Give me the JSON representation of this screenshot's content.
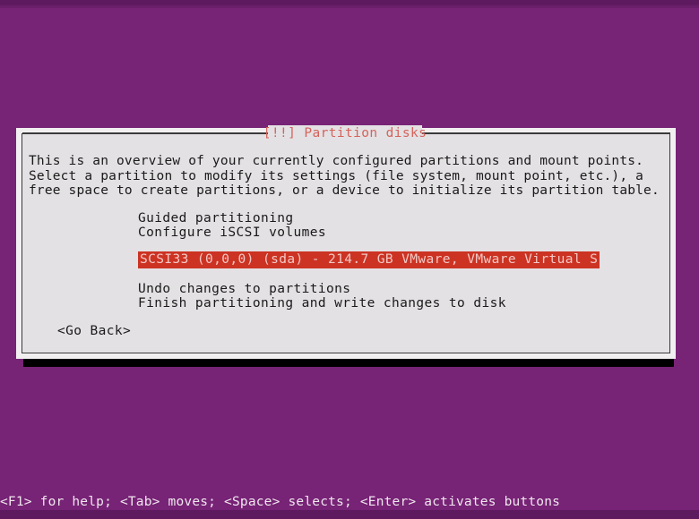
{
  "screen": {
    "background_color": "#772376",
    "top_strip_color": "#5e1a5e"
  },
  "dialog": {
    "title": "[!!] Partition disks",
    "title_color": "#d4645c",
    "background_color": "#e4e1e4",
    "border_color": "#3a3a3a",
    "intro_text": "This is an overview of your currently configured partitions and mount points. Select a partition to modify its settings (file system, mount point, etc.), a free space to create partitions, or a device to initialize its partition table.",
    "menu": {
      "guided_partitioning": "Guided partitioning",
      "configure_iscsi": "Configure iSCSI volumes",
      "selected_disk": "SCSI33 (0,0,0) (sda) - 214.7 GB VMware, VMware Virtual S",
      "undo_changes": "Undo changes to partitions",
      "finish_partitioning": "Finish partitioning and write changes to disk"
    },
    "selection": {
      "highlight_background": "#cc3323",
      "highlight_text_color": "#f3c8c4"
    },
    "buttons": {
      "go_back": "<Go Back>"
    }
  },
  "status_bar": {
    "hint": "<F1> for help; <Tab> moves; <Space> selects; <Enter> activates buttons",
    "text_color": "#f0e7ee"
  }
}
